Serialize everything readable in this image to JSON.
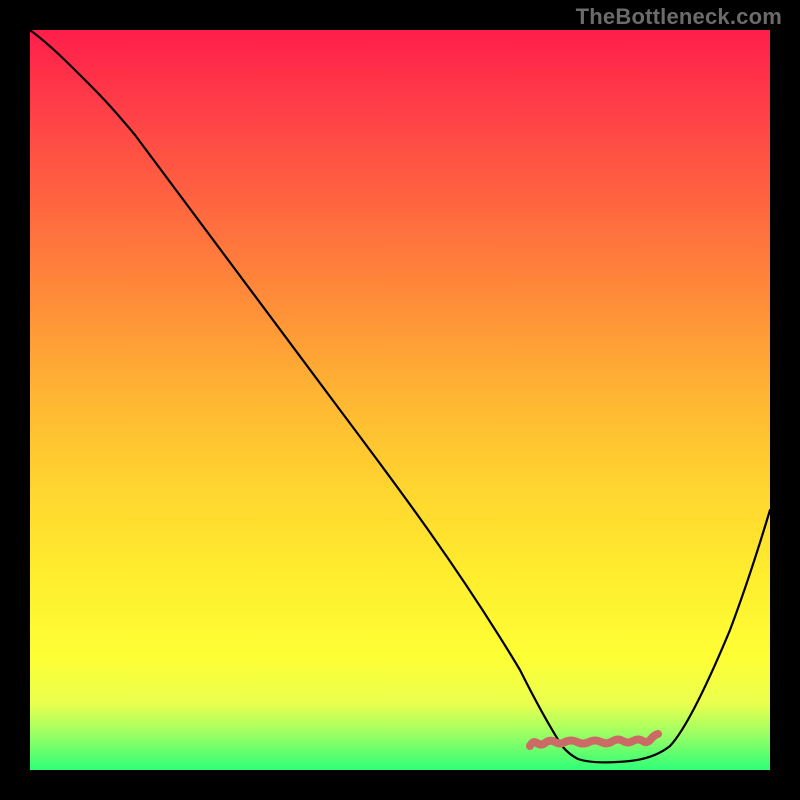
{
  "watermark": {
    "text": "TheBottleneck.com"
  },
  "chart_data": {
    "type": "line",
    "title": "",
    "xlabel": "",
    "ylabel": "",
    "xlim": [
      0,
      100
    ],
    "ylim": [
      0,
      100
    ],
    "x": [
      0,
      5,
      8,
      12,
      20,
      30,
      45,
      60,
      68,
      70,
      72,
      74,
      76,
      78,
      80,
      82,
      84,
      86,
      90,
      95,
      100
    ],
    "y": [
      100,
      97,
      94,
      90,
      80,
      68,
      50,
      30,
      10,
      6,
      3,
      2,
      1.5,
      1.2,
      1.2,
      1.5,
      2,
      3,
      12,
      30,
      45
    ],
    "floor_marker": {
      "x_range": [
        68,
        86
      ],
      "y": 1.5,
      "color": "#cc6b66",
      "note": "lumpy red wiggle at valley floor"
    },
    "colors": {
      "curve": "#000000",
      "gradient_top": "#ff1e4a",
      "gradient_bottom": "#2eff78"
    }
  }
}
